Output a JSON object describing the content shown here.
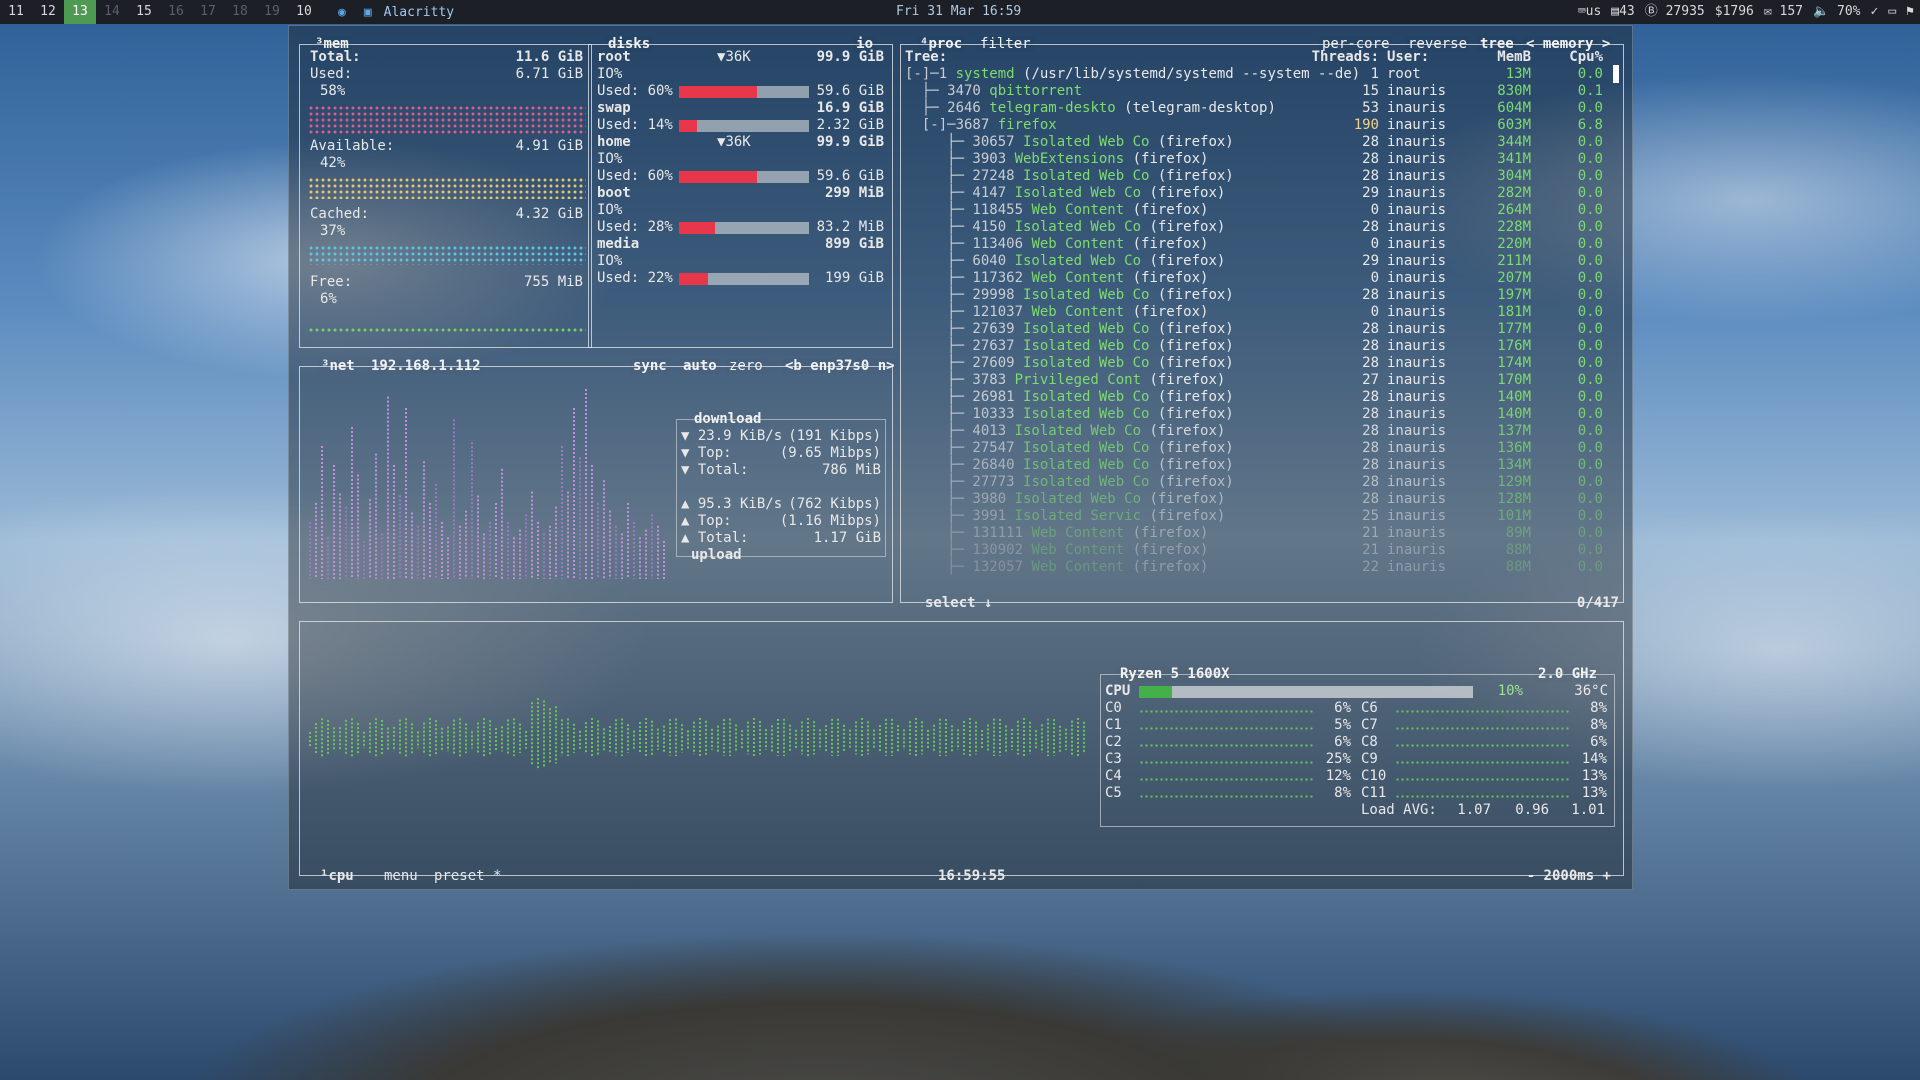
{
  "topbar": {
    "workspaces": [
      {
        "label": "11",
        "state": "normal"
      },
      {
        "label": "12",
        "state": "normal"
      },
      {
        "label": "13",
        "state": "active"
      },
      {
        "label": "14",
        "state": "dim"
      },
      {
        "label": "15",
        "state": "normal"
      },
      {
        "label": "16",
        "state": "dim"
      },
      {
        "label": "17",
        "state": "dim"
      },
      {
        "label": "18",
        "state": "dim"
      },
      {
        "label": "19",
        "state": "dim"
      },
      {
        "label": "10",
        "state": "normal"
      }
    ],
    "window_title": "Alacritty",
    "clock": "Fri 31 Mar 16:59",
    "kb_layout": "us",
    "tray": [
      "43",
      "27935",
      "1796",
      "157",
      "70%"
    ]
  },
  "mem": {
    "title": "mem",
    "total_label": "Total:",
    "total_value": "11.6 GiB",
    "used_label": "Used:",
    "used_value": "6.71 GiB",
    "used_pct": "58%",
    "available_label": "Available:",
    "available_value": "4.91 GiB",
    "available_pct": "42%",
    "cached_label": "Cached:",
    "cached_value": "4.32 GiB",
    "cached_pct": "37%",
    "free_label": "Free:",
    "free_value": "755 MiB",
    "free_pct": "6%"
  },
  "disks": {
    "title": "disks",
    "io_label": "io",
    "items": [
      {
        "name": "root",
        "io_rate": "36K",
        "total": "99.9 GiB",
        "io_label": "IO%",
        "used_label": "Used: 60%",
        "used_pct": 60,
        "used_value": "59.6 GiB"
      },
      {
        "name": "swap",
        "io_rate": "",
        "total": "16.9 GiB",
        "io_label": "",
        "used_label": "Used: 14%",
        "used_pct": 14,
        "used_value": "2.32 GiB"
      },
      {
        "name": "home",
        "io_rate": "36K",
        "total": "99.9 GiB",
        "io_label": "IO%",
        "used_label": "Used: 60%",
        "used_pct": 60,
        "used_value": "59.6 GiB"
      },
      {
        "name": "boot",
        "io_rate": "",
        "total": "299 MiB",
        "io_label": "IO%",
        "used_label": "Used: 28%",
        "used_pct": 28,
        "used_value": "83.2 MiB"
      },
      {
        "name": "media",
        "io_rate": "",
        "total": "899 GiB",
        "io_label": "IO%",
        "used_label": "Used: 22%",
        "used_pct": 22,
        "used_value": "199 GiB"
      }
    ]
  },
  "net": {
    "title": "net",
    "ip": "192.168.1.112",
    "opts": [
      "sync",
      "auto",
      "zero"
    ],
    "iface": "<b enp37s0 n>",
    "download_label": "download",
    "down_rate": "23.9 KiB/s",
    "down_rate_bits": "(191 Kibps)",
    "down_top_label": "Top:",
    "down_top": "(9.65 Mibps)",
    "down_total_label": "Total:",
    "down_total": "786 MiB",
    "up_rate": "95.3 KiB/s",
    "up_rate_bits": "(762 Kibps)",
    "up_top_label": "Top:",
    "up_top": "(1.16 Mibps)",
    "up_total_label": "Total:",
    "up_total": "1.17 GiB",
    "upload_label": "upload"
  },
  "proc": {
    "title": "proc",
    "filter": "filter",
    "opts": [
      "per-core",
      "reverse",
      "tree"
    ],
    "sort_label": "memory",
    "headers": {
      "tree": "Tree:",
      "threads": "Threads:",
      "user": "User:",
      "mem": "MemB",
      "cpu": "Cpu%"
    },
    "rows": [
      {
        "prefix": "[-]─1 ",
        "name": "systemd",
        "args": " (/usr/lib/systemd/systemd --system --de)",
        "threads": "1",
        "user": "root",
        "mem": "13M",
        "cpu": "0.0"
      },
      {
        "prefix": "  ├─ 3470 ",
        "name": "qbittorrent",
        "args": "",
        "threads": "15",
        "user": "inauris",
        "mem": "830M",
        "cpu": "0.1"
      },
      {
        "prefix": "  ├─ 2646 ",
        "name": "telegram-deskto",
        "args": " (telegram-desktop)",
        "threads": "53",
        "user": "inauris",
        "mem": "604M",
        "cpu": "0.0"
      },
      {
        "prefix": "  [-]─3687 ",
        "name": "firefox",
        "args": "",
        "threads": "190",
        "user": "inauris",
        "mem": "603M",
        "cpu": "6.8"
      },
      {
        "prefix": "     ├─ 30657 ",
        "name": "Isolated Web Co",
        "args": " (firefox)",
        "threads": "28",
        "user": "inauris",
        "mem": "344M",
        "cpu": "0.0"
      },
      {
        "prefix": "     ├─ 3903 ",
        "name": "WebExtensions",
        "args": " (firefox)",
        "threads": "28",
        "user": "inauris",
        "mem": "341M",
        "cpu": "0.0"
      },
      {
        "prefix": "     ├─ 27248 ",
        "name": "Isolated Web Co",
        "args": " (firefox)",
        "threads": "28",
        "user": "inauris",
        "mem": "304M",
        "cpu": "0.0"
      },
      {
        "prefix": "     ├─ 4147 ",
        "name": "Isolated Web Co",
        "args": " (firefox)",
        "threads": "29",
        "user": "inauris",
        "mem": "282M",
        "cpu": "0.0"
      },
      {
        "prefix": "     ├─ 118455 ",
        "name": "Web Content",
        "args": " (firefox)",
        "threads": "0",
        "user": "inauris",
        "mem": "264M",
        "cpu": "0.0"
      },
      {
        "prefix": "     ├─ 4150 ",
        "name": "Isolated Web Co",
        "args": " (firefox)",
        "threads": "28",
        "user": "inauris",
        "mem": "228M",
        "cpu": "0.0"
      },
      {
        "prefix": "     ├─ 113406 ",
        "name": "Web Content",
        "args": " (firefox)",
        "threads": "0",
        "user": "inauris",
        "mem": "220M",
        "cpu": "0.0"
      },
      {
        "prefix": "     ├─ 6040 ",
        "name": "Isolated Web Co",
        "args": " (firefox)",
        "threads": "29",
        "user": "inauris",
        "mem": "211M",
        "cpu": "0.0"
      },
      {
        "prefix": "     ├─ 117362 ",
        "name": "Web Content",
        "args": " (firefox)",
        "threads": "0",
        "user": "inauris",
        "mem": "207M",
        "cpu": "0.0"
      },
      {
        "prefix": "     ├─ 29998 ",
        "name": "Isolated Web Co",
        "args": " (firefox)",
        "threads": "28",
        "user": "inauris",
        "mem": "197M",
        "cpu": "0.0"
      },
      {
        "prefix": "     ├─ 121037 ",
        "name": "Web Content",
        "args": " (firefox)",
        "threads": "0",
        "user": "inauris",
        "mem": "181M",
        "cpu": "0.0"
      },
      {
        "prefix": "     ├─ 27639 ",
        "name": "Isolated Web Co",
        "args": " (firefox)",
        "threads": "28",
        "user": "inauris",
        "mem": "177M",
        "cpu": "0.0"
      },
      {
        "prefix": "     ├─ 27637 ",
        "name": "Isolated Web Co",
        "args": " (firefox)",
        "threads": "28",
        "user": "inauris",
        "mem": "176M",
        "cpu": "0.0"
      },
      {
        "prefix": "     ├─ 27609 ",
        "name": "Isolated Web Co",
        "args": " (firefox)",
        "threads": "28",
        "user": "inauris",
        "mem": "174M",
        "cpu": "0.0"
      },
      {
        "prefix": "     ├─ 3783 ",
        "name": "Privileged Cont",
        "args": " (firefox)",
        "threads": "27",
        "user": "inauris",
        "mem": "170M",
        "cpu": "0.0"
      },
      {
        "prefix": "     ├─ 26981 ",
        "name": "Isolated Web Co",
        "args": " (firefox)",
        "threads": "28",
        "user": "inauris",
        "mem": "140M",
        "cpu": "0.0"
      },
      {
        "prefix": "     ├─ 10333 ",
        "name": "Isolated Web Co",
        "args": " (firefox)",
        "threads": "28",
        "user": "inauris",
        "mem": "140M",
        "cpu": "0.0"
      },
      {
        "prefix": "     ├─ 4013 ",
        "name": "Isolated Web Co",
        "args": " (firefox)",
        "threads": "28",
        "user": "inauris",
        "mem": "137M",
        "cpu": "0.0"
      },
      {
        "prefix": "     ├─ 27547 ",
        "name": "Isolated Web Co",
        "args": " (firefox)",
        "threads": "28",
        "user": "inauris",
        "mem": "136M",
        "cpu": "0.0"
      },
      {
        "prefix": "     ├─ 26840 ",
        "name": "Isolated Web Co",
        "args": " (firefox)",
        "threads": "28",
        "user": "inauris",
        "mem": "134M",
        "cpu": "0.0"
      },
      {
        "prefix": "     ├─ 27773 ",
        "name": "Isolated Web Co",
        "args": " (firefox)",
        "threads": "28",
        "user": "inauris",
        "mem": "129M",
        "cpu": "0.0"
      },
      {
        "prefix": "     ├─ 3980 ",
        "name": "Isolated Web Co",
        "args": " (firefox)",
        "threads": "28",
        "user": "inauris",
        "mem": "128M",
        "cpu": "0.0"
      },
      {
        "prefix": "     ├─ 3991 ",
        "name": "Isolated Servic",
        "args": " (firefox)",
        "threads": "25",
        "user": "inauris",
        "mem": "101M",
        "cpu": "0.0"
      },
      {
        "prefix": "     ├─ 131111 ",
        "name": "Web Content",
        "args": " (firefox)",
        "threads": "21",
        "user": "inauris",
        "mem": "89M",
        "cpu": "0.0"
      },
      {
        "prefix": "     ├─ 130902 ",
        "name": "Web Content",
        "args": " (firefox)",
        "threads": "21",
        "user": "inauris",
        "mem": "88M",
        "cpu": "0.0"
      },
      {
        "prefix": "     ├─ 132057 ",
        "name": "Web Content",
        "args": " (firefox)",
        "threads": "22",
        "user": "inauris",
        "mem": "88M",
        "cpu": "0.0"
      }
    ],
    "select_label": "select",
    "count": "0/417"
  },
  "cpu": {
    "title": "cpu",
    "menu": "menu",
    "preset": "preset *",
    "clock": "16:59:55",
    "interval": "- 2000ms +",
    "model": "Ryzen 5 1600X",
    "freq": "2.0 GHz",
    "cpu_label": "CPU",
    "cpu_pct": "10%",
    "cpu_pct_value": 10,
    "temp": "36°C",
    "cores_left": [
      {
        "label": "C0",
        "pct": "6%"
      },
      {
        "label": "C1",
        "pct": "5%"
      },
      {
        "label": "C2",
        "pct": "6%"
      },
      {
        "label": "C3",
        "pct": "25%"
      },
      {
        "label": "C4",
        "pct": "12%"
      },
      {
        "label": "C5",
        "pct": "8%"
      }
    ],
    "cores_right": [
      {
        "label": "C6",
        "pct": "8%"
      },
      {
        "label": "C7",
        "pct": "8%"
      },
      {
        "label": "C8",
        "pct": "6%"
      },
      {
        "label": "C9",
        "pct": "14%"
      },
      {
        "label": "C10",
        "pct": "13%"
      },
      {
        "label": "C11",
        "pct": "13%"
      }
    ],
    "load_label": "Load AVG:",
    "load": [
      "1.07",
      "0.96",
      "1.01"
    ]
  },
  "colors": {
    "mem_used": "#e05b8a",
    "mem_available": "#e9c46a",
    "mem_cached": "#57c7e8",
    "mem_free": "#7ccf5f",
    "net_graph": "#b86ad6",
    "cpu_graph": "#63c65a",
    "bar_fill": "#e8364b"
  }
}
